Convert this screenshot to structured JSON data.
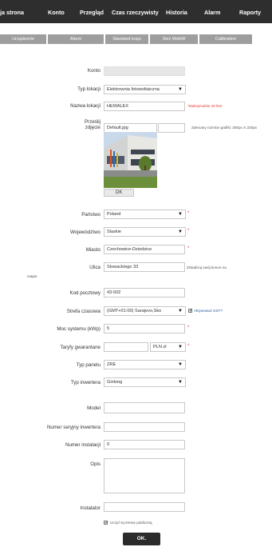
{
  "nav": {
    "items": [
      "ja strona",
      "Konto",
      "Przegląd",
      "Czas rzeczywisty",
      "Historia",
      "Alarm",
      "Raporty"
    ]
  },
  "tabs": [
    "Urządzenie",
    "Alarm",
    "Standard kraju",
    "Sieć WebW",
    "Calibration"
  ],
  "form": {
    "konto": {
      "label": "Konto",
      "value": ""
    },
    "typ_lokacji": {
      "label": "Typ lokacji",
      "value": "Elektrownia fotowoltaiczna"
    },
    "nazwa_lokacji": {
      "label": "Nazwa lokacji",
      "value": "HEWALEX",
      "hint": "*Maksymalnie 20 liter"
    },
    "zdjecie": {
      "label_line1": "Prześlij",
      "label_line2": "zdjęcie",
      "file_value": "Default.jpg",
      "hint": "Zalecany rozmiar grafiki: 300px X 220px",
      "ok_label": "OK"
    },
    "panstwo": {
      "label": "Państwo",
      "value": "Poland"
    },
    "wojewodztwo": {
      "label": "Województwo",
      "value": "Slaskie"
    },
    "miasto": {
      "label": "Miasto",
      "value": "Czechowice-Dziedzice"
    },
    "ulica": {
      "label": "Ulica",
      "value": "Slowackiego 33",
      "hint": "Zlokalizuj swój konon na",
      "hint2": "mapie"
    },
    "kod": {
      "label": "Kod pocztowy",
      "value": "43-502"
    },
    "strefa": {
      "label": "Strefa czasowa",
      "value": "(GMT+01:00) Sarajevo,Sko",
      "dst_label": "Aktywować DST?"
    },
    "moc": {
      "label": "Moc systemu (kWp)",
      "value": "5"
    },
    "taryfy": {
      "label": "Taryfy gwarantane",
      "value": "",
      "currency": "PLN zł"
    },
    "typ_panelu": {
      "label": "Typ panelu",
      "value": "ZRE"
    },
    "typ_inwertera": {
      "label": "Typ inwertera",
      "value": "Ginlong"
    },
    "model": {
      "label": "Model",
      "value": ""
    },
    "numer_seryjny": {
      "label": "Numer seryjny inwertera",
      "value": ""
    },
    "numer_instalacji": {
      "label": "Numer instalacji",
      "value": "0"
    },
    "opis": {
      "label": "Opis",
      "value": ""
    },
    "instalator": {
      "label": "Instalator",
      "value": ""
    },
    "public_label": "Uczyń tą stronę publiczną",
    "submit_label": "OK."
  },
  "required_mark": "*",
  "dropdown_arrow": "▼",
  "checkmark": "✔",
  "colors": {
    "nav_bg": "#2e2e2e",
    "tab_bg": "#9e9e9e",
    "required": "#e53935",
    "submit_bg": "#2b2b2b"
  }
}
